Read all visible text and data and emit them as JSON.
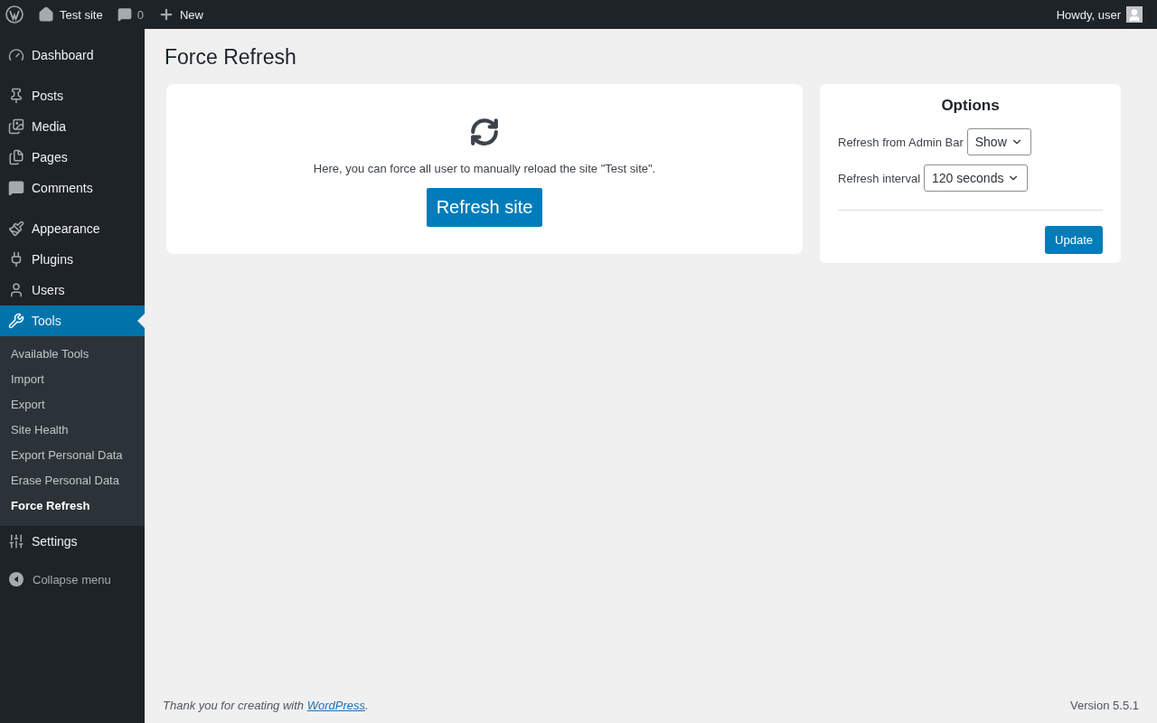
{
  "admin_bar": {
    "site": "Test site",
    "comments_count": "0",
    "new": "New",
    "greeting": "Howdy, user"
  },
  "menu_groups": [
    [
      {
        "label": "Dashboard",
        "selected": false
      }
    ],
    [
      {
        "label": "Posts",
        "selected": false
      },
      {
        "label": "Media",
        "selected": false
      },
      {
        "label": "Pages",
        "selected": false
      },
      {
        "label": "Comments",
        "selected": false
      }
    ],
    [
      {
        "label": "Appearance",
        "selected": false
      },
      {
        "label": "Plugins",
        "selected": false
      },
      {
        "label": "Users",
        "selected": false
      },
      {
        "label": "Tools",
        "selected": true,
        "submenu": [
          {
            "label": "Available Tools",
            "selected": false
          },
          {
            "label": "Import",
            "selected": false
          },
          {
            "label": "Export",
            "selected": false
          },
          {
            "label": "Site Health",
            "selected": false
          },
          {
            "label": "Export Personal Data",
            "selected": false
          },
          {
            "label": "Erase Personal Data",
            "selected": false
          },
          {
            "label": "Force Refresh",
            "selected": true
          }
        ]
      },
      {
        "label": "Settings",
        "selected": false
      }
    ]
  ],
  "collapse": "Collapse menu",
  "page_title": "Force Refresh",
  "main_card": {
    "text": "Here, you can force all user to manually reload the site \"Test site\".",
    "button": "Refresh site"
  },
  "options": {
    "title": "Options",
    "fields": [
      {
        "label": "Refresh from Admin Bar",
        "value": "Show"
      },
      {
        "label": "Refresh interval",
        "value": "120 seconds"
      }
    ],
    "button": "Update"
  },
  "footer": {
    "text_before": "Thank you for creating with ",
    "link": "WordPress",
    "text_after": ".",
    "version": "Version 5.5.1"
  }
}
